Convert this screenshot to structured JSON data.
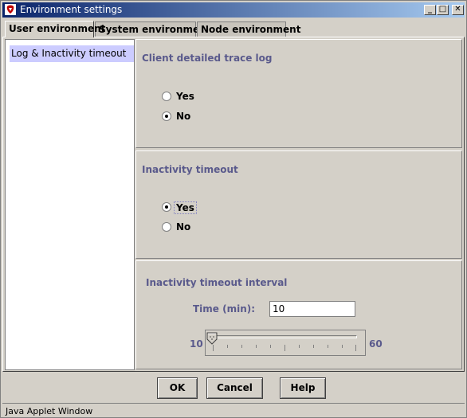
{
  "window": {
    "title": "Environment settings"
  },
  "tabs": [
    {
      "label": "User environment",
      "active": true
    },
    {
      "label": "System environment",
      "active": false
    },
    {
      "label": "Node environment",
      "active": false
    }
  ],
  "tree": {
    "items": [
      {
        "label": "Log & Inactivity timeout",
        "selected": true
      }
    ]
  },
  "trace_log": {
    "title": "Client detailed trace log",
    "options": [
      {
        "label": "Yes",
        "checked": false
      },
      {
        "label": "No",
        "checked": true
      }
    ]
  },
  "inactivity": {
    "title": "Inactivity timeout",
    "options": [
      {
        "label": "Yes",
        "checked": true
      },
      {
        "label": "No",
        "checked": false
      }
    ]
  },
  "interval": {
    "title": "Inactivity timeout interval",
    "time_label": "Time (min):",
    "time_value": "10",
    "slider_min": "10",
    "slider_max": "60",
    "slider_value": 10
  },
  "buttons": {
    "ok": "OK",
    "cancel": "Cancel",
    "help": "Help"
  },
  "status": "Java Applet Window",
  "colors": {
    "title_start": "#0a246a",
    "title_end": "#a6caf0",
    "section_title": "#5a5a8c",
    "selection": "#ccccff"
  }
}
